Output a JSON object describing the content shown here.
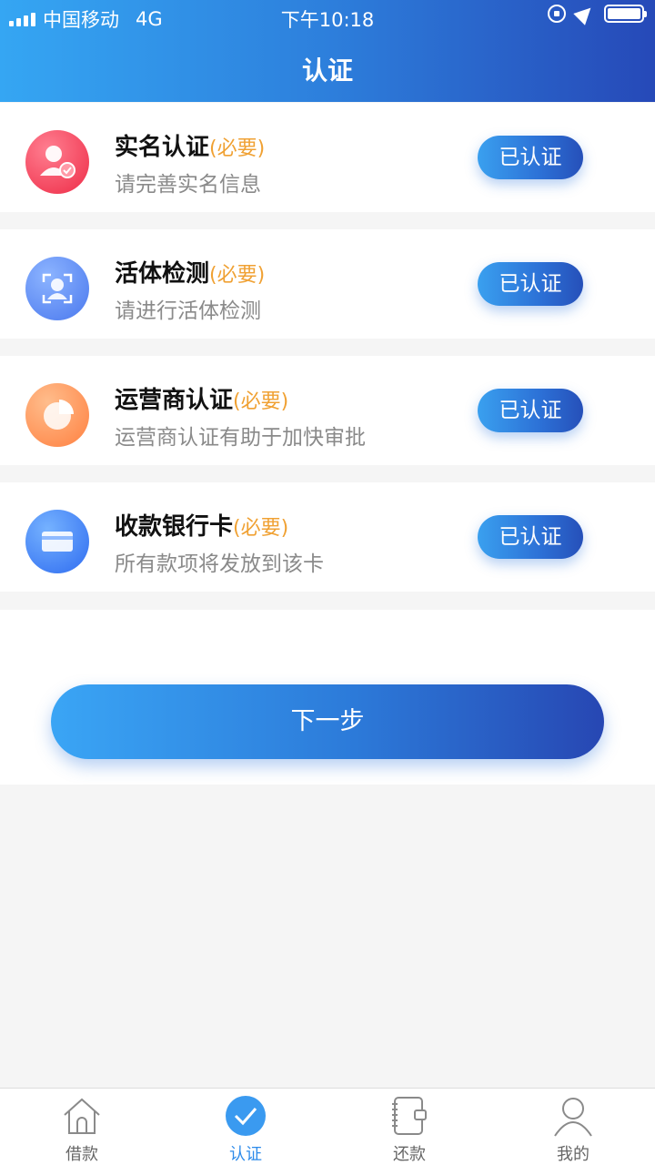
{
  "status_bar": {
    "carrier": "中国移动",
    "network": "4G",
    "time": "下午10:18"
  },
  "header": {
    "title": "认证"
  },
  "items": [
    {
      "name": "实名认证",
      "required": "(必要)",
      "desc": "请完善实名信息",
      "status": "已认证",
      "icon": "user-verify-icon",
      "color_from": "#ff6f83",
      "color_to": "#ee2c47"
    },
    {
      "name": "活体检测",
      "required": "(必要)",
      "desc": "请进行活体检测",
      "status": "已认证",
      "icon": "face-scan-icon",
      "color_from": "#7aa6ff",
      "color_to": "#4a78ee"
    },
    {
      "name": "运营商认证",
      "required": "(必要)",
      "desc": "运营商认证有助于加快审批",
      "status": "已认证",
      "icon": "pie-chart-icon",
      "color_from": "#ffb07a",
      "color_to": "#ff8040"
    },
    {
      "name": "收款银行卡",
      "required": "(必要)",
      "desc": "所有款项将发放到该卡",
      "status": "已认证",
      "icon": "bank-card-icon",
      "color_from": "#5fa4ff",
      "color_to": "#2f6cf0"
    }
  ],
  "next_button": "下一步",
  "tabs": [
    {
      "label": "借款",
      "icon": "home-icon"
    },
    {
      "label": "认证",
      "icon": "check-circle-icon",
      "active": true
    },
    {
      "label": "还款",
      "icon": "wallet-icon"
    },
    {
      "label": "我的",
      "icon": "profile-icon"
    }
  ]
}
